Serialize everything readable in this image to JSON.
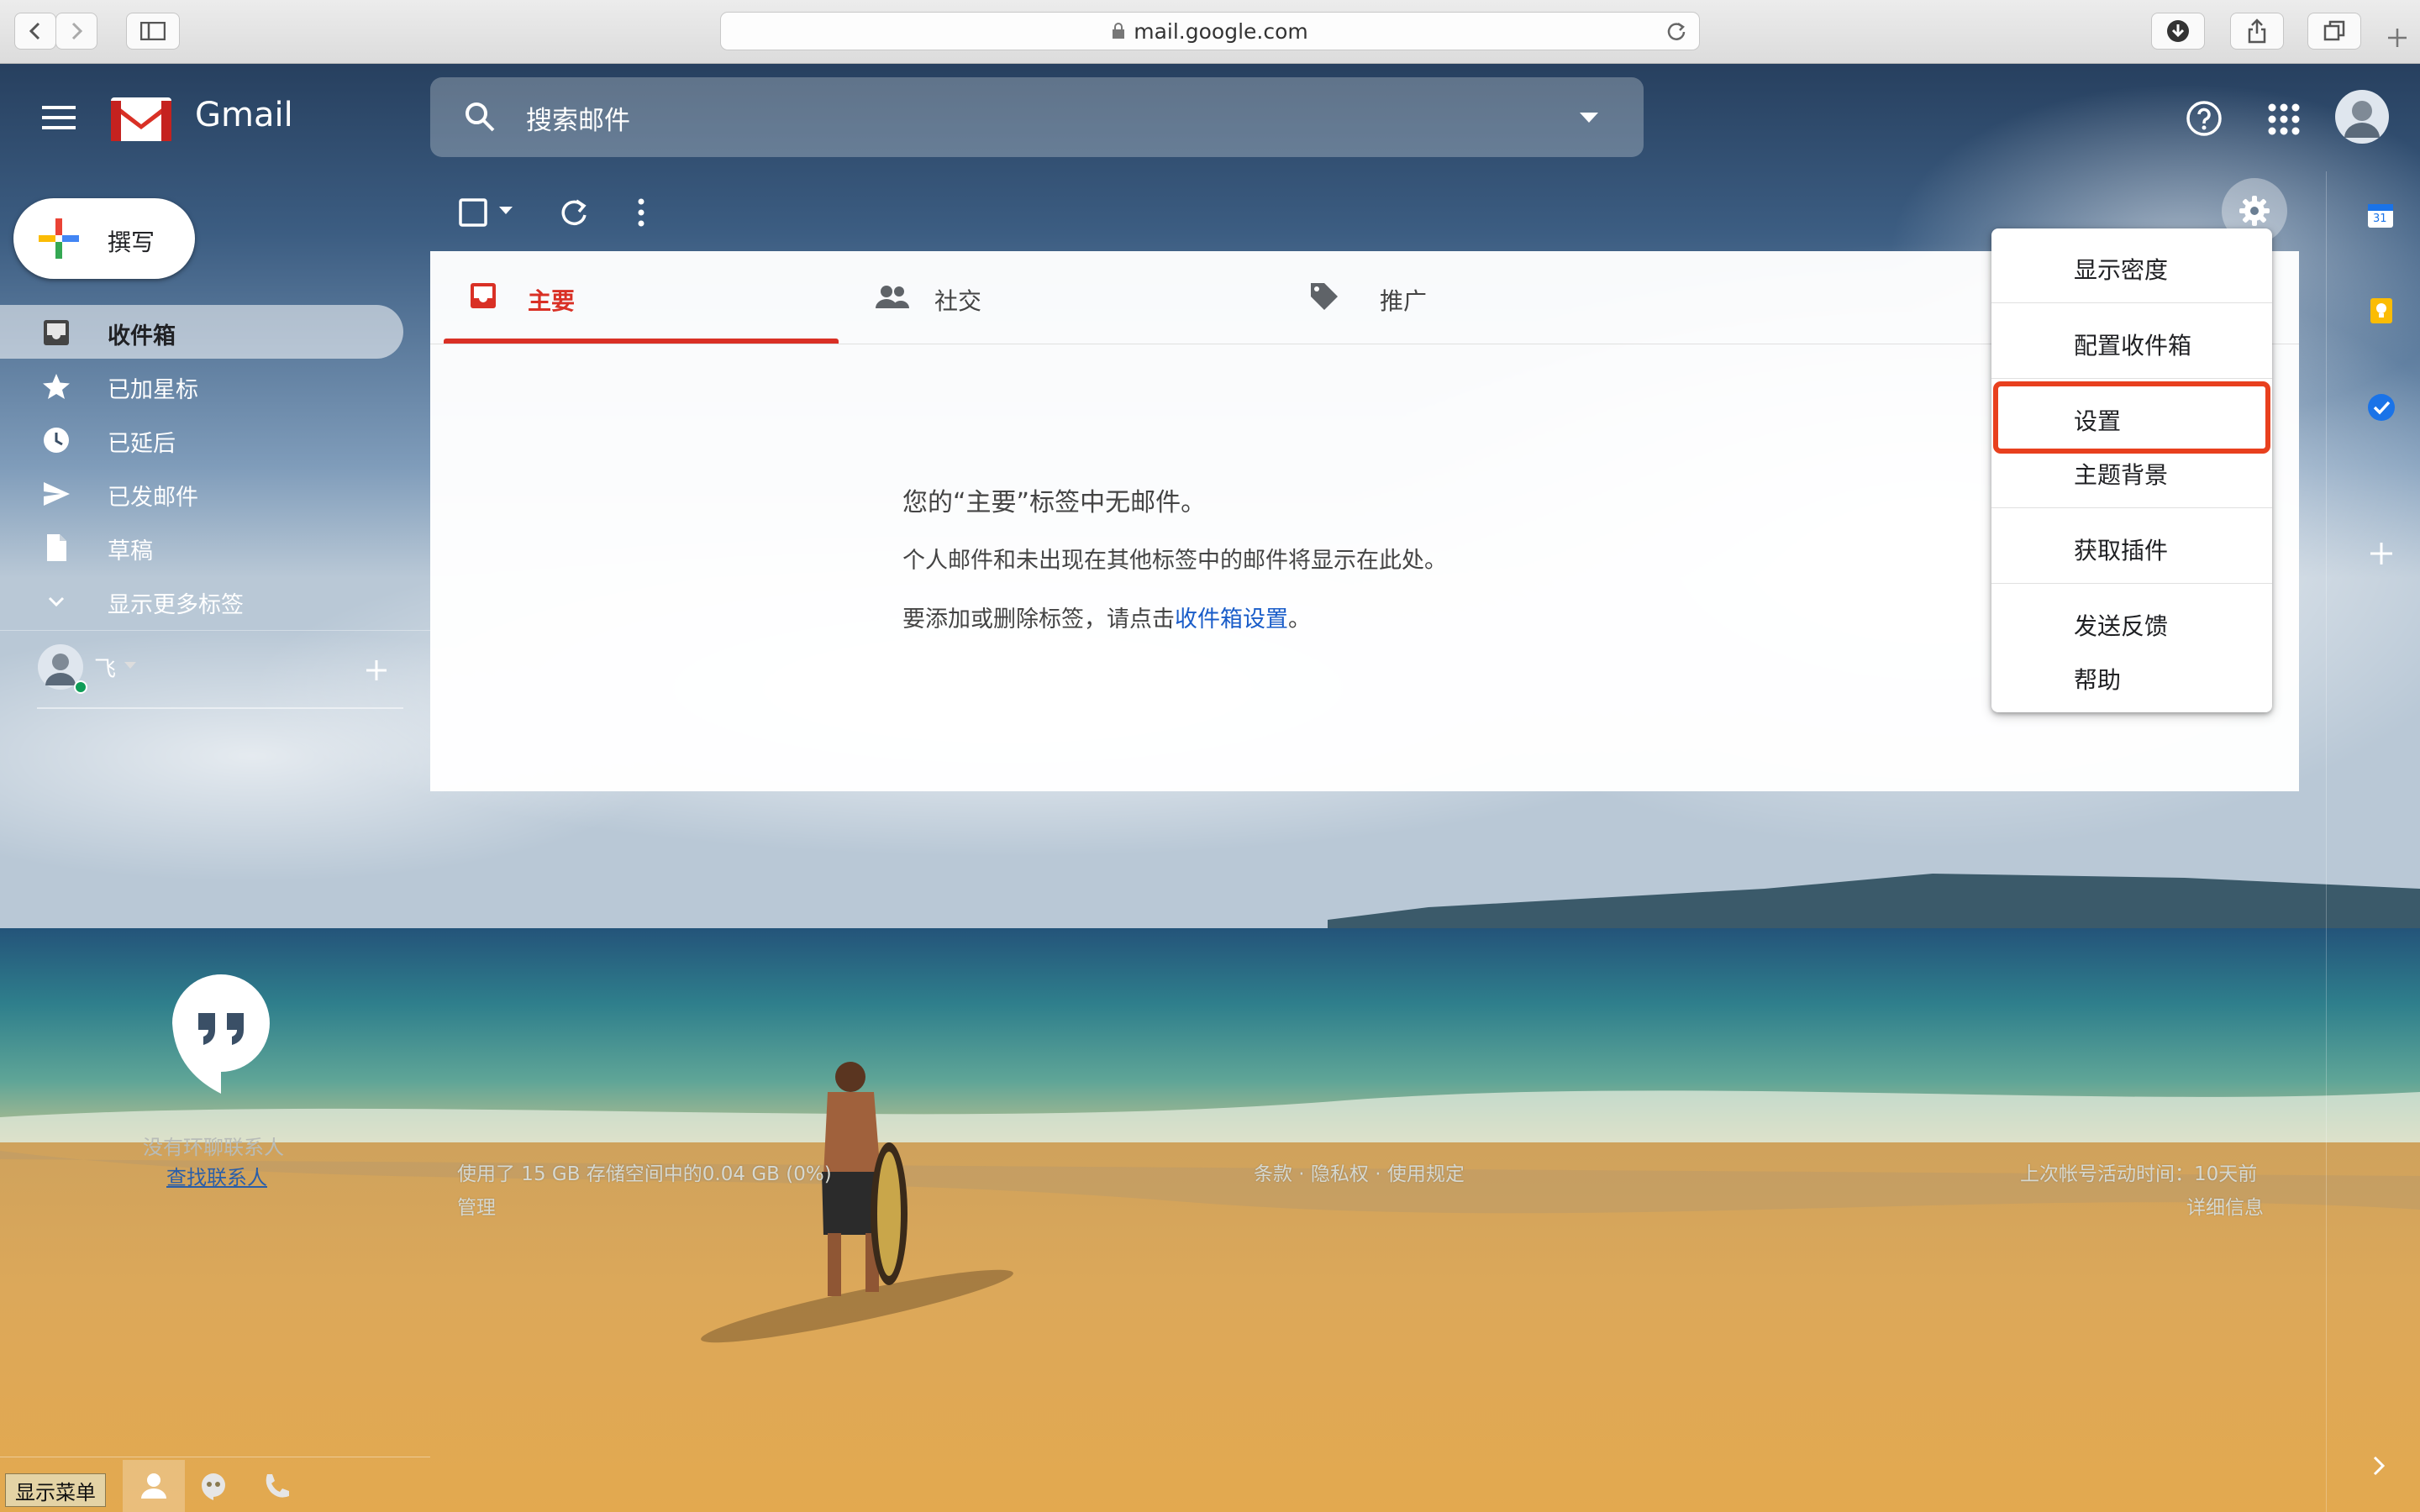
{
  "browser": {
    "url": "mail.google.com"
  },
  "header": {
    "app_name": "Gmail",
    "search_placeholder": "搜索邮件"
  },
  "sidebar": {
    "compose_label": "撰写",
    "items": [
      {
        "label": "收件箱",
        "icon": "inbox-icon",
        "active": true
      },
      {
        "label": "已加星标",
        "icon": "star-icon",
        "active": false
      },
      {
        "label": "已延后",
        "icon": "clock-icon",
        "active": false
      },
      {
        "label": "已发邮件",
        "icon": "send-icon",
        "active": false
      },
      {
        "label": "草稿",
        "icon": "draft-icon",
        "active": false
      },
      {
        "label": "显示更多标签",
        "icon": "chevron-down-icon",
        "active": false
      }
    ],
    "hangouts_user": "飞",
    "hangouts_empty": "没有环聊联系人",
    "hangouts_find": "查找联系人"
  },
  "tabs": [
    {
      "label": "主要",
      "icon": "inbox-tab-icon",
      "active": true
    },
    {
      "label": "社交",
      "icon": "people-icon",
      "active": false
    },
    {
      "label": "推广",
      "icon": "tag-icon",
      "active": false
    }
  ],
  "empty_state": {
    "title": "您的“主要”标签中无邮件。",
    "line1": "个人邮件和未出现在其他标签中的邮件将显示在此处。",
    "line2_prefix": "要添加或删除标签，请点击",
    "line2_link": "收件箱设置",
    "line2_suffix": "。"
  },
  "settings_menu": {
    "items": [
      "显示密度",
      "配置收件箱",
      "设置",
      "主题背景",
      "获取插件",
      "发送反馈",
      "帮助"
    ],
    "highlighted": "设置"
  },
  "footer": {
    "storage": "使用了 15 GB 存储空间中的0.04 GB (0%)",
    "manage": "管理",
    "links": "条款 · 隐私权 · 使用规定",
    "last_activity": "上次帐号活动时间：10天前",
    "details": "详细信息"
  },
  "bottom_bar": {
    "show_menu": "显示菜单"
  },
  "side_panel": {
    "calendar_day": "31"
  },
  "colors": {
    "accent_red": "#d93025",
    "link_blue": "#1a5dc9",
    "highlight_box": "#e8401e"
  }
}
